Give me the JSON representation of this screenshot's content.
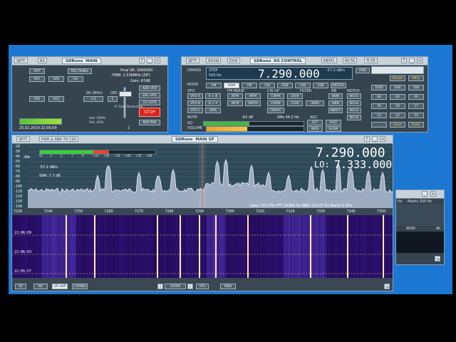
{
  "main_window": {
    "sett_label": "SETT.",
    "rx_label": "RX",
    "title": "SDRuno",
    "title_tab": "MAIN",
    "opt_label": "OPT",
    "rec_panel_label": "REC PANEL",
    "sp1_label": "SP1",
    "sp2_label": "SP2",
    "rx_btn_label": "RX",
    "final_sr": "Final SR: 2000000",
    "ifbw": "IFBW: 1.536MHz (ZIF)",
    "gain": "Gain: 87dB",
    "irq_label": "IRQ",
    "agc_label": "AGC",
    "sr_label": "SR (MHz)",
    "dec_label": "DEC",
    "sr_value": "2.0",
    "dec_value": "1",
    "rf_gain_label": "RF Gain",
    "if_gain_label": "IF Gain Reduction",
    "add_vrx": "ADD VRX",
    "del_vrx": "DEL VRX",
    "lo_lock": "LO LOCK",
    "stop": "STOP",
    "min_pan": "MIN PAN",
    "cpu_label": "Sdr: 100%",
    "cpu_label2": "Sdr: 42%",
    "datetime": "25.02.2019  22:06:09",
    "corner_number": "2"
  },
  "rx_window": {
    "sett_label": "SETT.",
    "rdsw_label": "RDSW",
    "exw_label": "EXW",
    "title": "SDRuno",
    "title_tab": "RX CONTROL",
    "kbyp_label": "KBYP1",
    "mcta_label": "MCTA",
    "tctr_label": "TCTR",
    "demod": "DEMOD",
    "step_label": "STEP",
    "step_value": "500 Hz",
    "frequency": "7.290.000",
    "signal_dbm": "-57.2 dBm",
    "rms_label": "RMS",
    "mode_label": "MODE",
    "modes": [
      "AM",
      "SAM",
      "FM",
      "CW",
      "DSB",
      "LSB",
      "USB",
      "DIGITAL"
    ],
    "vfo_label": "VFO",
    "vfo_buttons": [
      "VFO A",
      "A > B",
      "VFO B",
      "B > A",
      "VFO C"
    ],
    "fm_mode": "FM MODE",
    "fm_buttons": [
      "NFM",
      "MFM",
      "WFM",
      "SWFM"
    ],
    "cw_op": "CW OP",
    "cw_buttons": [
      "CWPK",
      "CWRK",
      "CWAFC"
    ],
    "filter_label": "FILTER",
    "filter_values": [
      "2000",
      "2200",
      "3000"
    ],
    "nb_label": "NB",
    "nb_buttons": [
      "NBW",
      "NBN",
      "NBOFF"
    ],
    "notch_label": "NOTCH",
    "notch_buttons": [
      "NCH1",
      "NCH2",
      "NCH3",
      "NCH4"
    ],
    "qms_label": "QMS",
    "qms_btn": "QMS",
    "mute_label": "MUTE",
    "sq_label": "SQ",
    "squelch_db": "-84 dB",
    "offs_label": "Offs 44.2 Hz",
    "agc_label": "AGC",
    "agc_buttons": [
      "OFF",
      "FAST",
      "MED",
      "SLOW"
    ],
    "volume_label": "VOLUME",
    "keypad": [
      "Bands",
      "MHz",
      "2200",
      "630",
      "160",
      "80",
      "60",
      "40",
      "30",
      "20",
      "17",
      "15",
      "12",
      "10",
      "Clear",
      "Enter"
    ]
  },
  "spectrum_window": {
    "sett_label": "SETT.",
    "title": "PWR & SNR TO CSV",
    "brand": "SDRuno",
    "brand_tab": "MAIN SP",
    "db_ticks": [
      "-20",
      "-30",
      "-40",
      "-50",
      "-60",
      "-70",
      "-80",
      "-90",
      "-100",
      "-110",
      "-120",
      "-130",
      "-140"
    ],
    "db_unit": "dBm",
    "smeter_ticks": [
      "S1",
      "3",
      "5",
      "7",
      "9",
      "+10",
      "+20",
      "+30",
      "+40",
      "+50",
      "+60"
    ],
    "signal_dbm": "-57.2 dBm",
    "snr": "SNR: 7.7 dB",
    "freq_main": "7.290.000",
    "lo_label": "LO:",
    "freq_lo": "7.333.000",
    "span_info": "Span 125 KHz   FFT 16384 Hz   RBW 122.07 Hz   Marks 1 KHz",
    "freq_ticks": [
      "7230",
      "7240",
      "7250",
      "7260",
      "7270",
      "7280",
      "7290",
      "7300",
      "7310",
      "7320",
      "7330",
      "7340",
      "7350"
    ],
    "wf_times": [
      "22:06:09",
      "22:06:03",
      "22:05:57"
    ],
    "bottom_buttons": [
      "SP",
      "WF",
      "SP+WP",
      "COMBO",
      "ZOOM",
      "VFO",
      "RBW"
    ]
  },
  "aux_window": {
    "hz_label": "Hz",
    "marks_label": "Marks 200 Hz",
    "tick_4000": "4000",
    "tick_4k": "4k"
  },
  "colors": {
    "desktop": "#1c77d2",
    "window_bg": "#36444f",
    "spectrum_fill": "#b2bdd3",
    "waterfall_bg": "#220a55",
    "carrier": "#ffe9a8"
  }
}
